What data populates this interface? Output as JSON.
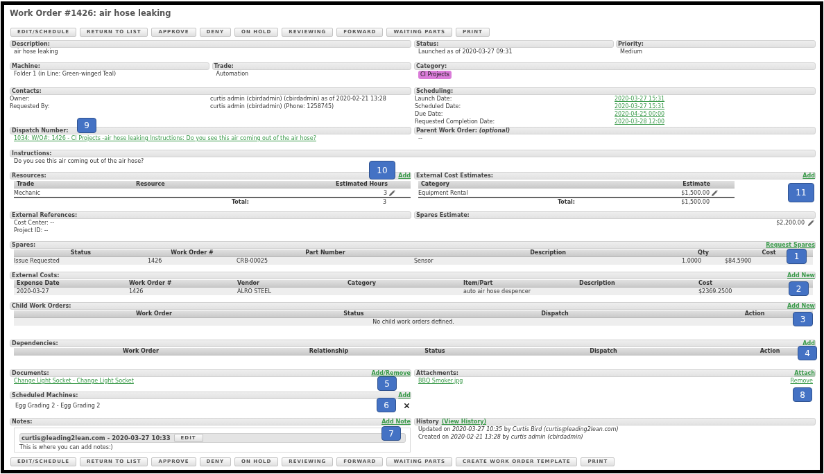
{
  "page_title": "Work Order #1426: air hose leaking",
  "top_buttons": [
    "EDIT/SCHEDULE",
    "RETURN TO LIST",
    "APPROVE",
    "DENY",
    "ON HOLD",
    "REVIEWING",
    "FORWARD",
    "WAITING PARTS",
    "PRINT"
  ],
  "description": {
    "label": "Description:",
    "value": "air hose leaking"
  },
  "status": {
    "label": "Status:",
    "value": "Launched as of 2020-03-27 09:31"
  },
  "priority": {
    "label": "Priority:",
    "value": "Medium"
  },
  "machine": {
    "label": "Machine:",
    "value": "Folder 1 (in Line: Green-winged Teal)"
  },
  "trade": {
    "label": "Trade:",
    "value": "Automation"
  },
  "category": {
    "label": "Category:",
    "tag": "CI Projects",
    "color": "#da7cd9"
  },
  "contacts": {
    "label": "Contacts:",
    "fields": [
      {
        "name": "Owner:",
        "value": "curtis admin (cbirdadmin) (cbirdadmin) as of 2020-02-21 13:28"
      },
      {
        "name": "Requested By:",
        "value": "curtis admin (cbirdadmin) (Phone: 1258745)"
      }
    ]
  },
  "scheduling": {
    "label": "Scheduling:",
    "fields": [
      {
        "name": "Launch Date:",
        "value": "2020-03-27 15:31"
      },
      {
        "name": "Scheduled Date:",
        "value": "2020-03-27 15:31"
      },
      {
        "name": "Due Date:",
        "value": "2020-04-25 00:00"
      },
      {
        "name": "Requested Completion Date:",
        "value": "2020-03-28 12:00"
      }
    ]
  },
  "dispatch_number": {
    "label": "Dispatch Number:",
    "link": "1034: W/O#: 1426 - CI Projects -air hose leaking Instructions: Do you see this air coming out of the air hose?"
  },
  "parent_work_order": {
    "label": "Parent Work Order: *(optional)*",
    "value": "--"
  },
  "instructions": {
    "label": "Instructions:",
    "value": "Do you see this air coming out of the air hose?"
  },
  "resources": {
    "label": "Resources:",
    "action": "Add",
    "columns": [
      "Trade",
      "Resource",
      "Estimated Hours"
    ],
    "rows": [
      {
        "trade": "Mechanic",
        "hours": "3"
      }
    ],
    "total_label": "Total:",
    "total": "3"
  },
  "external_cost_estimates": {
    "label": "External Cost Estimates:",
    "action": "Add",
    "columns": [
      "Category",
      "Estimate"
    ],
    "rows": [
      {
        "category": "Equipment Rental",
        "estimate": "$1,500.00"
      }
    ],
    "total_label": "Total:",
    "total": "$1,500.00"
  },
  "external_references": {
    "label": "External References:",
    "lines": [
      "Cost Center: --",
      "Project ID: --"
    ]
  },
  "spares_estimate": {
    "label": "Spares Estimate:",
    "value": "$2,200.00"
  },
  "spares": {
    "label": "Spares:",
    "action": "Request Spares",
    "columns": [
      "Status",
      "Work Order #",
      "Part Number",
      "Description",
      "Qty",
      "Cost"
    ],
    "rows": [
      {
        "status": "Issue Requested",
        "work_order": "1426",
        "part_number": "CRB-00025",
        "description": "Sensor",
        "qty": "1.0000",
        "cost": "$84.5900"
      }
    ]
  },
  "external_costs": {
    "label": "External Costs:",
    "action": "Add New",
    "columns": [
      "Expense Date",
      "Work Order #",
      "Vendor",
      "Category",
      "Item/Part",
      "Description",
      "Cost"
    ],
    "rows": [
      {
        "expense_date": "2020-03-27",
        "work_order": "1426",
        "vendor": "ALRO STEEL",
        "item_part": "auto air hose despencer",
        "cost": "$2369.2500"
      }
    ]
  },
  "child_work_orders": {
    "label": "Child Work Orders:",
    "action": "Add New",
    "columns": [
      "Work Order",
      "Status",
      "Dispatch",
      "Action"
    ],
    "empty_message": "No child work orders defined."
  },
  "dependencies": {
    "label": "Dependencies:",
    "action": "Add",
    "columns": [
      "Work Order",
      "Relationship",
      "Status",
      "Dispatch",
      "Action"
    ]
  },
  "documents": {
    "label": "Documents:",
    "action": "Add/Remove",
    "links": [
      "Change Light Socket - Change Light Socket"
    ]
  },
  "attachments": {
    "label": "Attachments:",
    "action": "Attach",
    "files": [
      {
        "name": "BBQ Smoker.jpg",
        "action": "Remove"
      }
    ]
  },
  "scheduled_machines": {
    "label": "Scheduled Machines:",
    "action": "Add",
    "items": [
      "Egg Grading 2 - Egg Grading 2"
    ]
  },
  "notes": {
    "label": "Notes:",
    "action": "Add Note",
    "entries": [
      {
        "author": "curtis@leading2lean.com - 2020-03-27 10:33",
        "button": "EDIT",
        "text": "This is where you can add notes:)"
      }
    ]
  },
  "history": {
    "label": "History",
    "link": "(View History)",
    "entries": [
      "Updated on *2020-03-27 10:35* by *Curtis Bird (curtis@leading2lean.com)*",
      "Created on *2020-02-21 13:28* by *curtis admin (cbirdadmin)*"
    ]
  },
  "bottom_buttons": [
    "EDIT/SCHEDULE",
    "RETURN TO LIST",
    "APPROVE",
    "DENY",
    "ON HOLD",
    "REVIEWING",
    "FORWARD",
    "WAITING PARTS",
    "CREATE WORK ORDER TEMPLATE",
    "PRINT"
  ],
  "callouts": [
    {
      "label": "9"
    },
    {
      "label": "10"
    },
    {
      "label": "11"
    },
    {
      "label": "1"
    },
    {
      "label": "2"
    },
    {
      "label": "3"
    },
    {
      "label": "4"
    },
    {
      "label": "5"
    },
    {
      "label": "8"
    },
    {
      "label": "6"
    },
    {
      "label": "7"
    }
  ]
}
